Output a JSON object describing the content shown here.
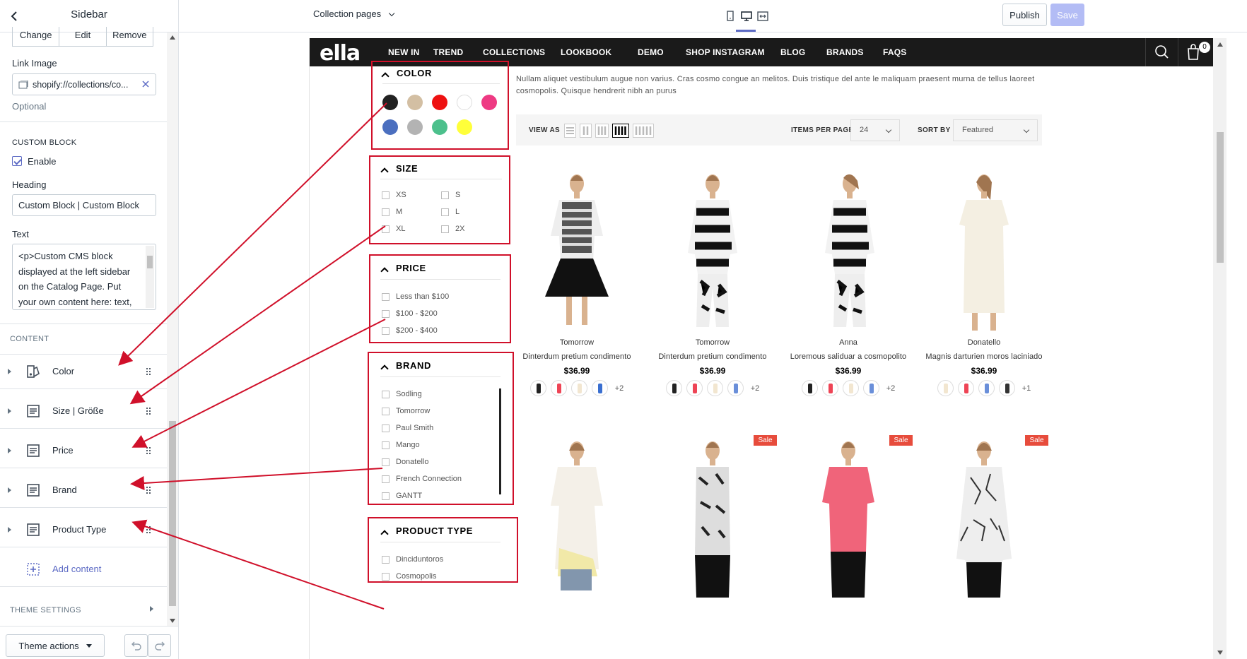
{
  "sidebar": {
    "title": "Sidebar",
    "link_buttons": [
      "Change",
      "Edit",
      "Remove"
    ],
    "link_image_label": "Link Image",
    "link_image_value": "shopify://collections/co...",
    "link_image_help": "Optional",
    "custom_block_heading": "CUSTOM BLOCK",
    "enable_label": "Enable",
    "heading_label": "Heading",
    "heading_value": "Custom Block | Custom Block",
    "text_label": "Text",
    "text_value": "<p>Custom CMS block displayed at the left sidebar on the Catalog Page. Put your own content here: text, html,",
    "content_heading": "CONTENT",
    "blocks": [
      "Color",
      "Size | Größe",
      "Price",
      "Brand",
      "Product Type"
    ],
    "add_content": "Add content",
    "theme_settings": "THEME SETTINGS",
    "theme_actions": "Theme actions"
  },
  "topbar": {
    "page_select": "Collection pages",
    "publish": "Publish",
    "save": "Save"
  },
  "store": {
    "logo": "ella",
    "nav": [
      "NEW IN",
      "TREND",
      "COLLECTIONS",
      "LOOKBOOK",
      "DEMO",
      "SHOP INSTAGRAM",
      "BLOG",
      "BRANDS",
      "FAQS"
    ],
    "cart_count": "0",
    "intro": "Nullam aliquet vestibulum augue non varius. Cras cosmo congue an melitos. Duis tristique del ante le maliquam praesent murna de tellus laoreet cosmopolis. Quisque hendrerit nibh an purus",
    "filters": {
      "color": {
        "title": "COLOR",
        "swatches": [
          "#222222",
          "#d3bfa3",
          "#ee1111",
          "#ffffff",
          "#ee3a83",
          "#4b6fbf",
          "#b3b3b3",
          "#4cc08c",
          "#ffff3a"
        ]
      },
      "size": {
        "title": "SIZE",
        "options": [
          "XS",
          "S",
          "M",
          "L",
          "XL",
          "2X"
        ]
      },
      "price": {
        "title": "PRICE",
        "options": [
          "Less than $100",
          "$100 - $200",
          "$200 - $400"
        ]
      },
      "brand": {
        "title": "BRAND",
        "options": [
          "Sodling",
          "Tomorrow",
          "Paul Smith",
          "Mango",
          "Donatello",
          "French Connection",
          "GANTT"
        ]
      },
      "product_type": {
        "title": "PRODUCT TYPE",
        "options": [
          "Dinciduntoros",
          "Cosmopolis"
        ]
      }
    },
    "toolbar": {
      "view_as": "VIEW AS",
      "items_per_page_label": "ITEMS PER PAGE",
      "items_per_page_value": "24",
      "sort_by_label": "SORT BY",
      "sort_by_value": "Featured"
    },
    "products": [
      {
        "brand": "Tomorrow",
        "name": "Dinterdum pretium condimento",
        "price": "$36.99",
        "more": "+2",
        "swatches": [
          "#222222",
          "#ee4455",
          "#f2e6d0",
          "#3a6fd0"
        ]
      },
      {
        "brand": "Tomorrow",
        "name": "Dinterdum pretium condimento",
        "price": "$36.99",
        "more": "+2",
        "swatches": [
          "#222222",
          "#ee4455",
          "#f2e6d0",
          "#6a8fd9"
        ]
      },
      {
        "brand": "Anna",
        "name": "Loremous saliduar a cosmopolito",
        "price": "$36.99",
        "more": "+2",
        "swatches": [
          "#222222",
          "#ee4455",
          "#f2e6d0",
          "#6a8fd9"
        ]
      },
      {
        "brand": "Donatello",
        "name": "Magnis darturien moros laciniado",
        "price": "$36.99",
        "more": "+1",
        "swatches": [
          "#f2e6d0",
          "#ee4455",
          "#6a8fd9",
          "#333333"
        ]
      }
    ],
    "sale_label": "Sale"
  }
}
